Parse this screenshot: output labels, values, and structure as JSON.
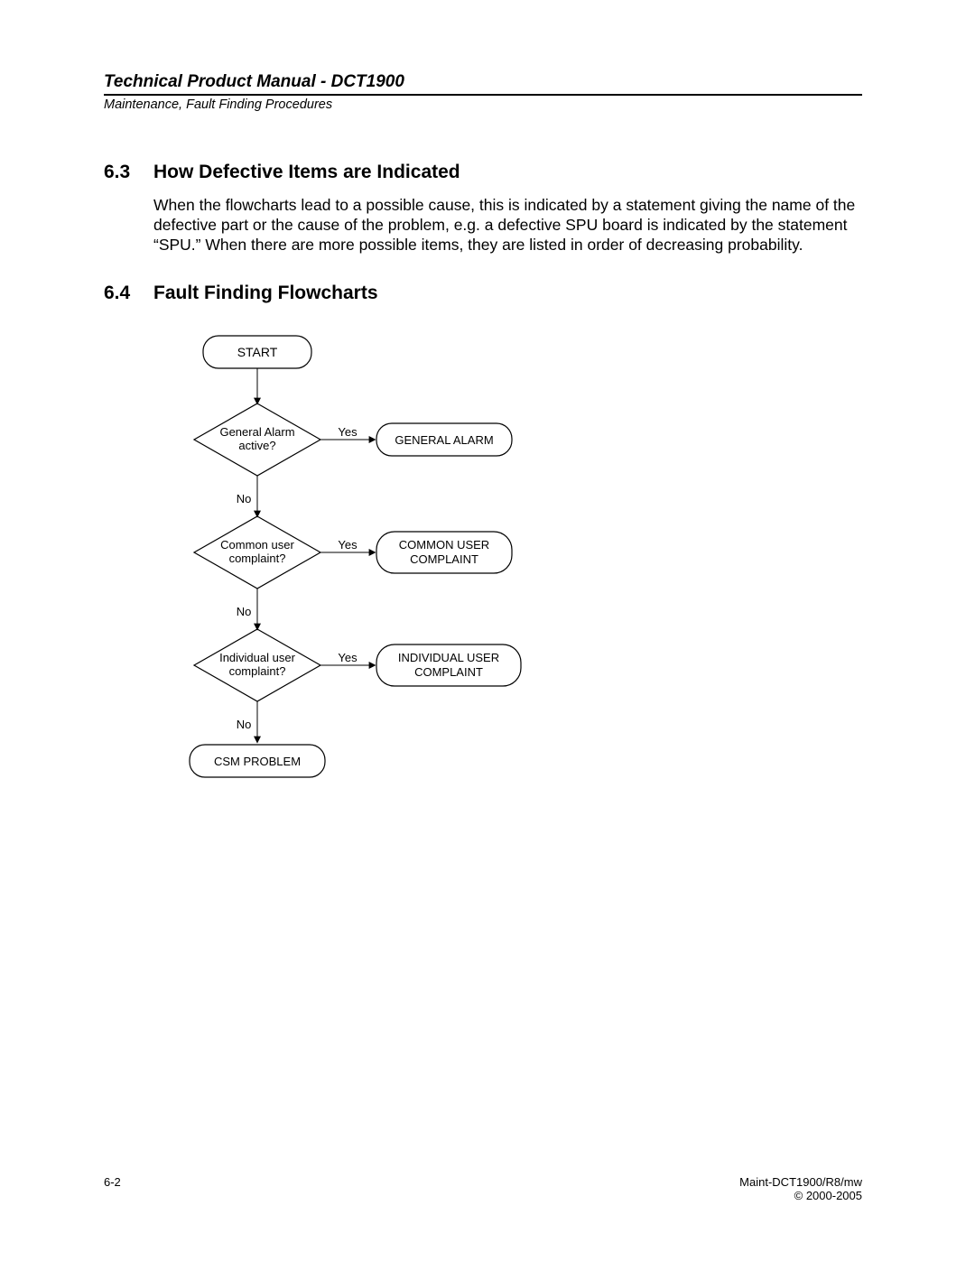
{
  "header": {
    "title": "Technical Product Manual - DCT1900",
    "subtitle": "Maintenance, Fault Finding Procedures"
  },
  "sections": {
    "s63": {
      "num": "6.3",
      "title": "How Defective Items are Indicated",
      "body": "When the flowcharts lead to a possible cause, this is indicated by a statement giving the name of the defective part or the cause of the problem, e.g. a defective SPU board is indicated by the statement “SPU.”  When there are more possible items, they are listed in order of decreasing probability."
    },
    "s64": {
      "num": "6.4",
      "title": "Fault Finding Flowcharts"
    }
  },
  "flow": {
    "start": "START",
    "d1_l1": "General Alarm",
    "d1_l2": "active?",
    "r1": "GENERAL ALARM",
    "d2_l1": "Common user",
    "d2_l2": "complaint?",
    "r2_l1": "COMMON USER",
    "r2_l2": "COMPLAINT",
    "d3_l1": "Individual user",
    "d3_l2": "complaint?",
    "r3_l1": "INDIVIDUAL USER",
    "r3_l2": "COMPLAINT",
    "end": "CSM PROBLEM",
    "yes": "Yes",
    "no": "No"
  },
  "footer": {
    "left": "6-2",
    "right1": "Maint-DCT1900/R8/mw",
    "right2": "© 2000-2005"
  }
}
